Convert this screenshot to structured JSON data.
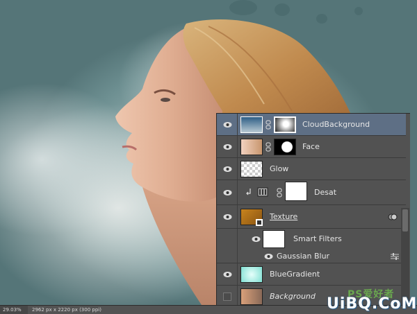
{
  "layers_panel": {
    "layers": [
      {
        "name": "CloudBackground",
        "visible": true,
        "selected": true,
        "italic": false,
        "underlined": false
      },
      {
        "name": "Face",
        "visible": true,
        "selected": false,
        "italic": false,
        "underlined": false
      },
      {
        "name": "Glow",
        "visible": true,
        "selected": false,
        "italic": false,
        "underlined": false
      },
      {
        "name": "Desat",
        "visible": true,
        "selected": false,
        "italic": false,
        "underlined": false
      },
      {
        "name": "Texture",
        "visible": true,
        "selected": false,
        "italic": false,
        "underlined": true
      },
      {
        "name": "Smart Filters",
        "visible": true,
        "selected": false,
        "italic": false,
        "underlined": false
      },
      {
        "name": "Gaussian Blur",
        "visible": true,
        "selected": false,
        "italic": false,
        "underlined": false
      },
      {
        "name": "BlueGradient",
        "visible": true,
        "selected": false,
        "italic": false,
        "underlined": false
      },
      {
        "name": "Background",
        "visible": false,
        "selected": false,
        "italic": true,
        "underlined": false
      }
    ]
  },
  "status_bar": {
    "zoom": "29.03%",
    "doc_info": "2962 px x 2220 px (300 ppi)"
  },
  "watermark": {
    "top_text": "PS爱好者",
    "bottom_text": "UiBQ.CoM"
  },
  "colors": {
    "panel_bg": "#525252",
    "selected_row": "#5e6f85",
    "status_bg": "#535353"
  }
}
